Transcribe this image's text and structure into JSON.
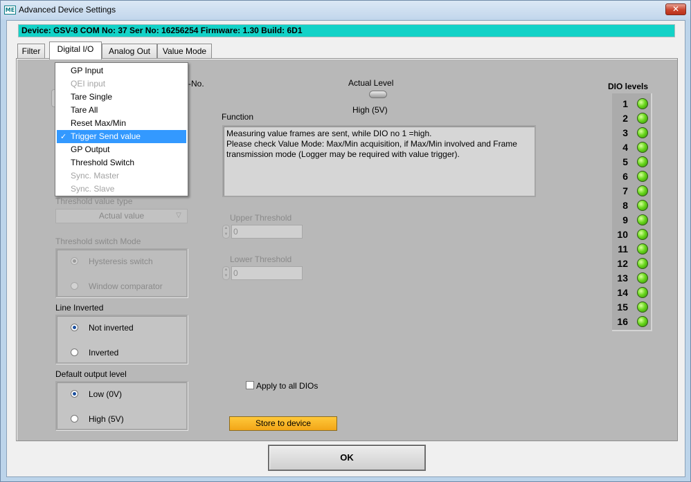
{
  "window": {
    "title": "Advanced Device Settings",
    "app_icon_text": "ME",
    "close_glyph": "✕"
  },
  "device_bar": "Device: GSV-8 COM No: 37 Ser No: 16256254 Firmware: 1.30 Build: 6D1",
  "tabs": [
    {
      "label": "Filter",
      "active": false
    },
    {
      "label": "Digital I/O",
      "active": true
    },
    {
      "label": "Analog Out",
      "active": false
    },
    {
      "label": "Value Mode",
      "active": false
    }
  ],
  "dio_no_label_fragment": "-No.",
  "actual_level": {
    "label": "Actual Level",
    "value": "High (5V)"
  },
  "function": {
    "label": "Function",
    "text_line1": "Measuring value frames are sent, while DIO no 1 =high.",
    "text_line2": "Please check Value Mode: Max/Min acquisition, if Max/Min involved and Frame",
    "text_line3": "transmission mode (Logger may be required with value trigger)."
  },
  "dropdown": {
    "items": [
      {
        "label": "GP Input",
        "enabled": true,
        "selected": false
      },
      {
        "label": "QEI input",
        "enabled": false,
        "selected": false
      },
      {
        "label": "Tare Single",
        "enabled": true,
        "selected": false
      },
      {
        "label": "Tare All",
        "enabled": true,
        "selected": false
      },
      {
        "label": "Reset Max/Min",
        "enabled": true,
        "selected": false
      },
      {
        "label": "Trigger Send value",
        "enabled": true,
        "selected": true
      },
      {
        "label": "GP Output",
        "enabled": true,
        "selected": false
      },
      {
        "label": "Threshold Switch",
        "enabled": true,
        "selected": false
      },
      {
        "label": "Sync. Master",
        "enabled": false,
        "selected": false
      },
      {
        "label": "Sync. Slave",
        "enabled": false,
        "selected": false
      }
    ],
    "check_glyph": "✓"
  },
  "threshold_value_type": {
    "label": "Threshold value type",
    "value": "Actual value",
    "arrow_glyph": "▽"
  },
  "threshold_switch_mode": {
    "label": "Threshold switch Mode",
    "options": [
      {
        "label": "Hysteresis switch",
        "checked": true
      },
      {
        "label": "Window comparator",
        "checked": false
      }
    ]
  },
  "line_inverted": {
    "label": "Line Inverted",
    "options": [
      {
        "label": "Not inverted",
        "checked": true
      },
      {
        "label": "Inverted",
        "checked": false
      }
    ]
  },
  "default_output_level": {
    "label": "Default output level",
    "options": [
      {
        "label": "Low (0V)",
        "checked": true
      },
      {
        "label": "High (5V)",
        "checked": false
      }
    ]
  },
  "upper_threshold": {
    "label": "Upper Threshold",
    "value": "0"
  },
  "lower_threshold": {
    "label": "Lower Threshold",
    "value": "0"
  },
  "apply_all": {
    "label": "Apply to all DIOs",
    "checked": false
  },
  "store_button": "Store to device",
  "ok_button": "OK",
  "dio_levels": {
    "title": "DIO levels",
    "numbers": [
      "1",
      "2",
      "3",
      "4",
      "5",
      "6",
      "7",
      "8",
      "9",
      "10",
      "11",
      "12",
      "13",
      "14",
      "15",
      "16"
    ],
    "led_color": "#6bd81e"
  }
}
